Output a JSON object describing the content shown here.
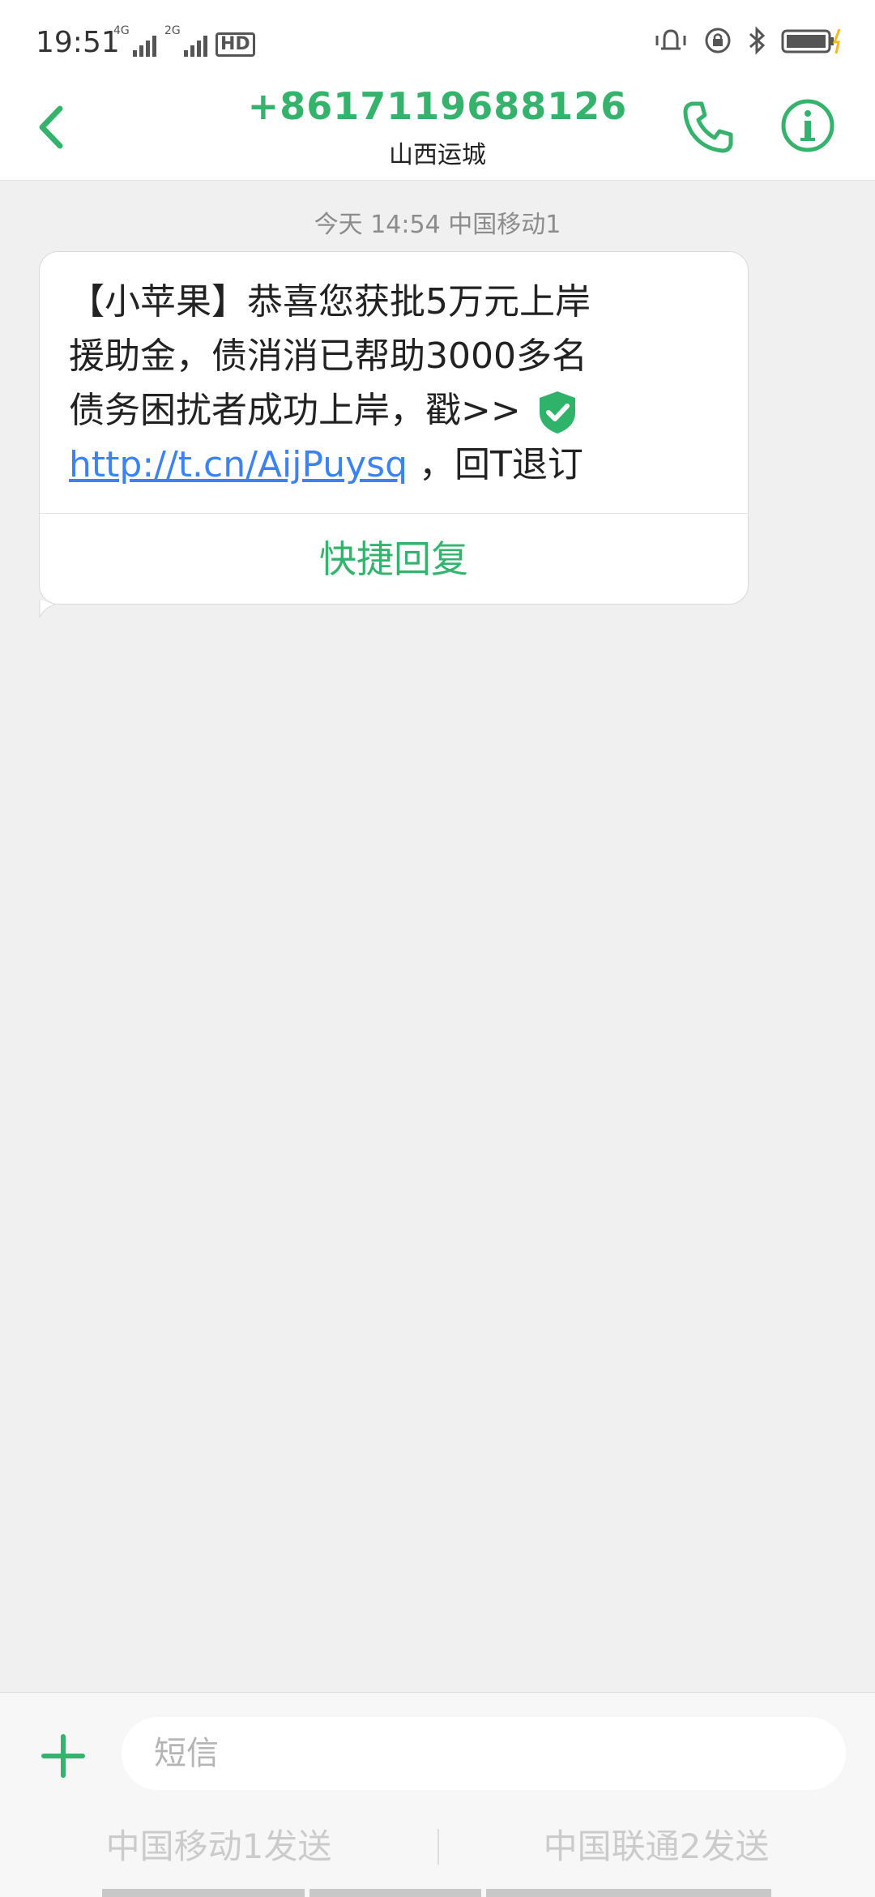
{
  "status_bar": {
    "time": "19:51",
    "net1_label": "4G",
    "net2_label": "2G",
    "hd_label": "HD"
  },
  "header": {
    "phone_number": "+8617119688126",
    "location": "山西运城"
  },
  "conversation": {
    "timestamp": "今天 14:54  中国移动1",
    "message": {
      "line1": "【小苹果】恭喜您获批5万元上岸",
      "line2": "援助金，债消消已帮助3000多名",
      "line3": "债务困扰者成功上岸，戳>>",
      "link": "http://t.cn/AijPuysq",
      "suffix": " ，回T退订"
    },
    "quick_reply_label": "快捷回复"
  },
  "composer": {
    "placeholder": "短信",
    "send_sim1_label": "中国移动1发送",
    "send_sim2_label": "中国联通2发送"
  },
  "colors": {
    "accent": "#35b36c",
    "link": "#3b82f6",
    "background": "#f0f0f0"
  }
}
